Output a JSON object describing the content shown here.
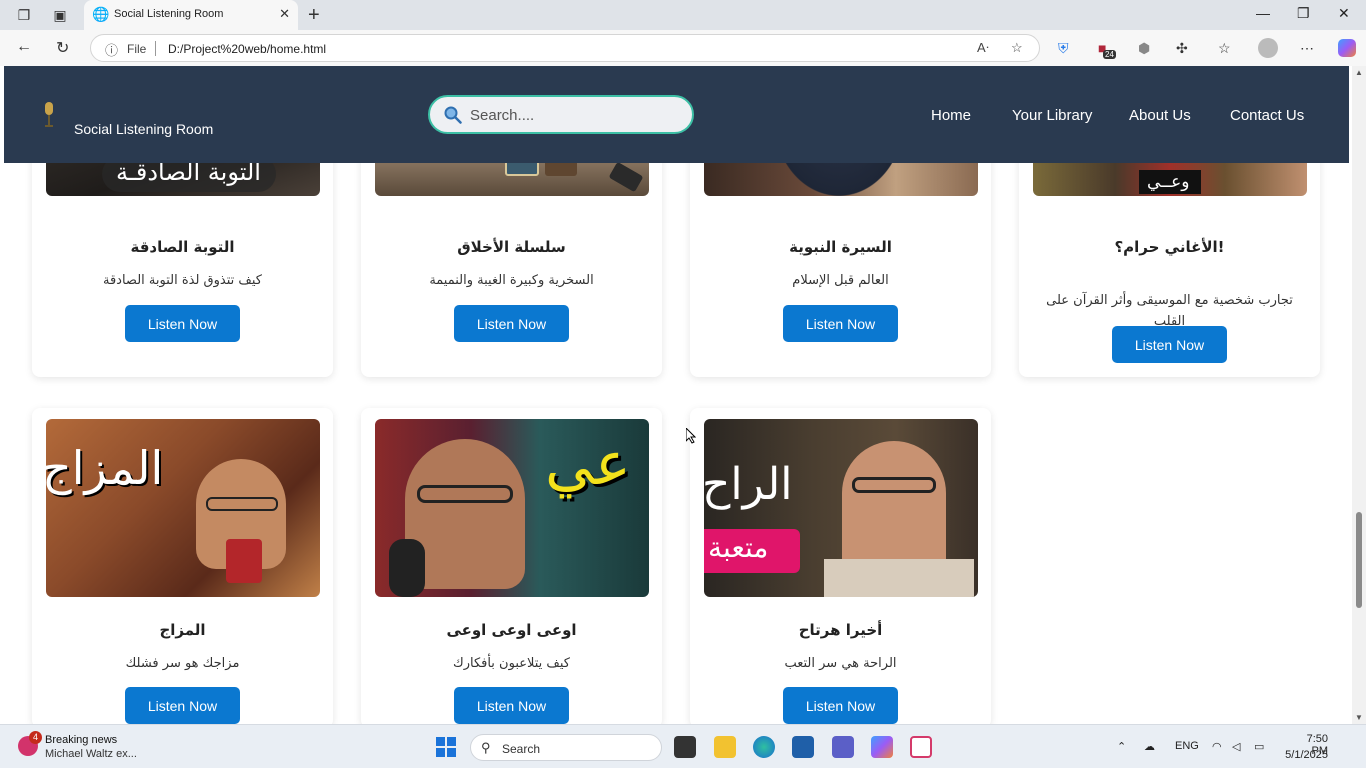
{
  "browser": {
    "tab_title": "Social Listening Room",
    "file_label": "File",
    "url": "D:/Project%20web/home.html",
    "extension_badge": "24"
  },
  "site": {
    "brand": "Social Listening Room",
    "search_placeholder": "Search....",
    "nav": [
      "Home",
      "Your Library",
      "About Us",
      "Contact Us"
    ]
  },
  "cards": [
    {
      "title": "التوبة الصادقة",
      "desc": "كيف تتذوق لذة التوبة الصادقة",
      "button": "Listen Now",
      "thumb_text": "التوبة الصادقـة"
    },
    {
      "title": "سلسلة الأخلاق",
      "desc": "السخرية وكبيرة الغيبة والنميمة",
      "button": "Listen Now",
      "thumb_text": ""
    },
    {
      "title": "السيرة النبوية",
      "desc": "العالم قبل الإسلام",
      "button": "Listen Now",
      "thumb_text": ""
    },
    {
      "title": "!الأغاني حرام؟",
      "desc": "تجارب شخصية مع الموسيقى وأثر القرآن على القلب",
      "button": "Listen Now",
      "thumb_text": "وعــي"
    },
    {
      "title": "المزاج",
      "desc": "مزاجك هو سر فشلك",
      "button": "Listen Now",
      "thumb_text": "المزاج"
    },
    {
      "title": "اوعى اوعى اوعى",
      "desc": "كيف يتلاعبون بأفكارك",
      "button": "Listen Now",
      "thumb_text": "عي"
    },
    {
      "title": "أخيرا هرتاح",
      "desc": "الراحة هي سر التعب",
      "button": "Listen Now",
      "thumb_text": "الراح",
      "thumb_text2": "متعبة"
    }
  ],
  "taskbar": {
    "news_badge": "4",
    "news_title": "Breaking news",
    "news_sub": "Michael Waltz ex...",
    "search_label": "Search",
    "lang": "ENG",
    "time": "7:50 PM",
    "date": "5/1/2025"
  },
  "colors": {
    "nav_bg": "#2a3a50",
    "button_blue": "#0b78d0",
    "search_border": "#3cbfa5"
  }
}
